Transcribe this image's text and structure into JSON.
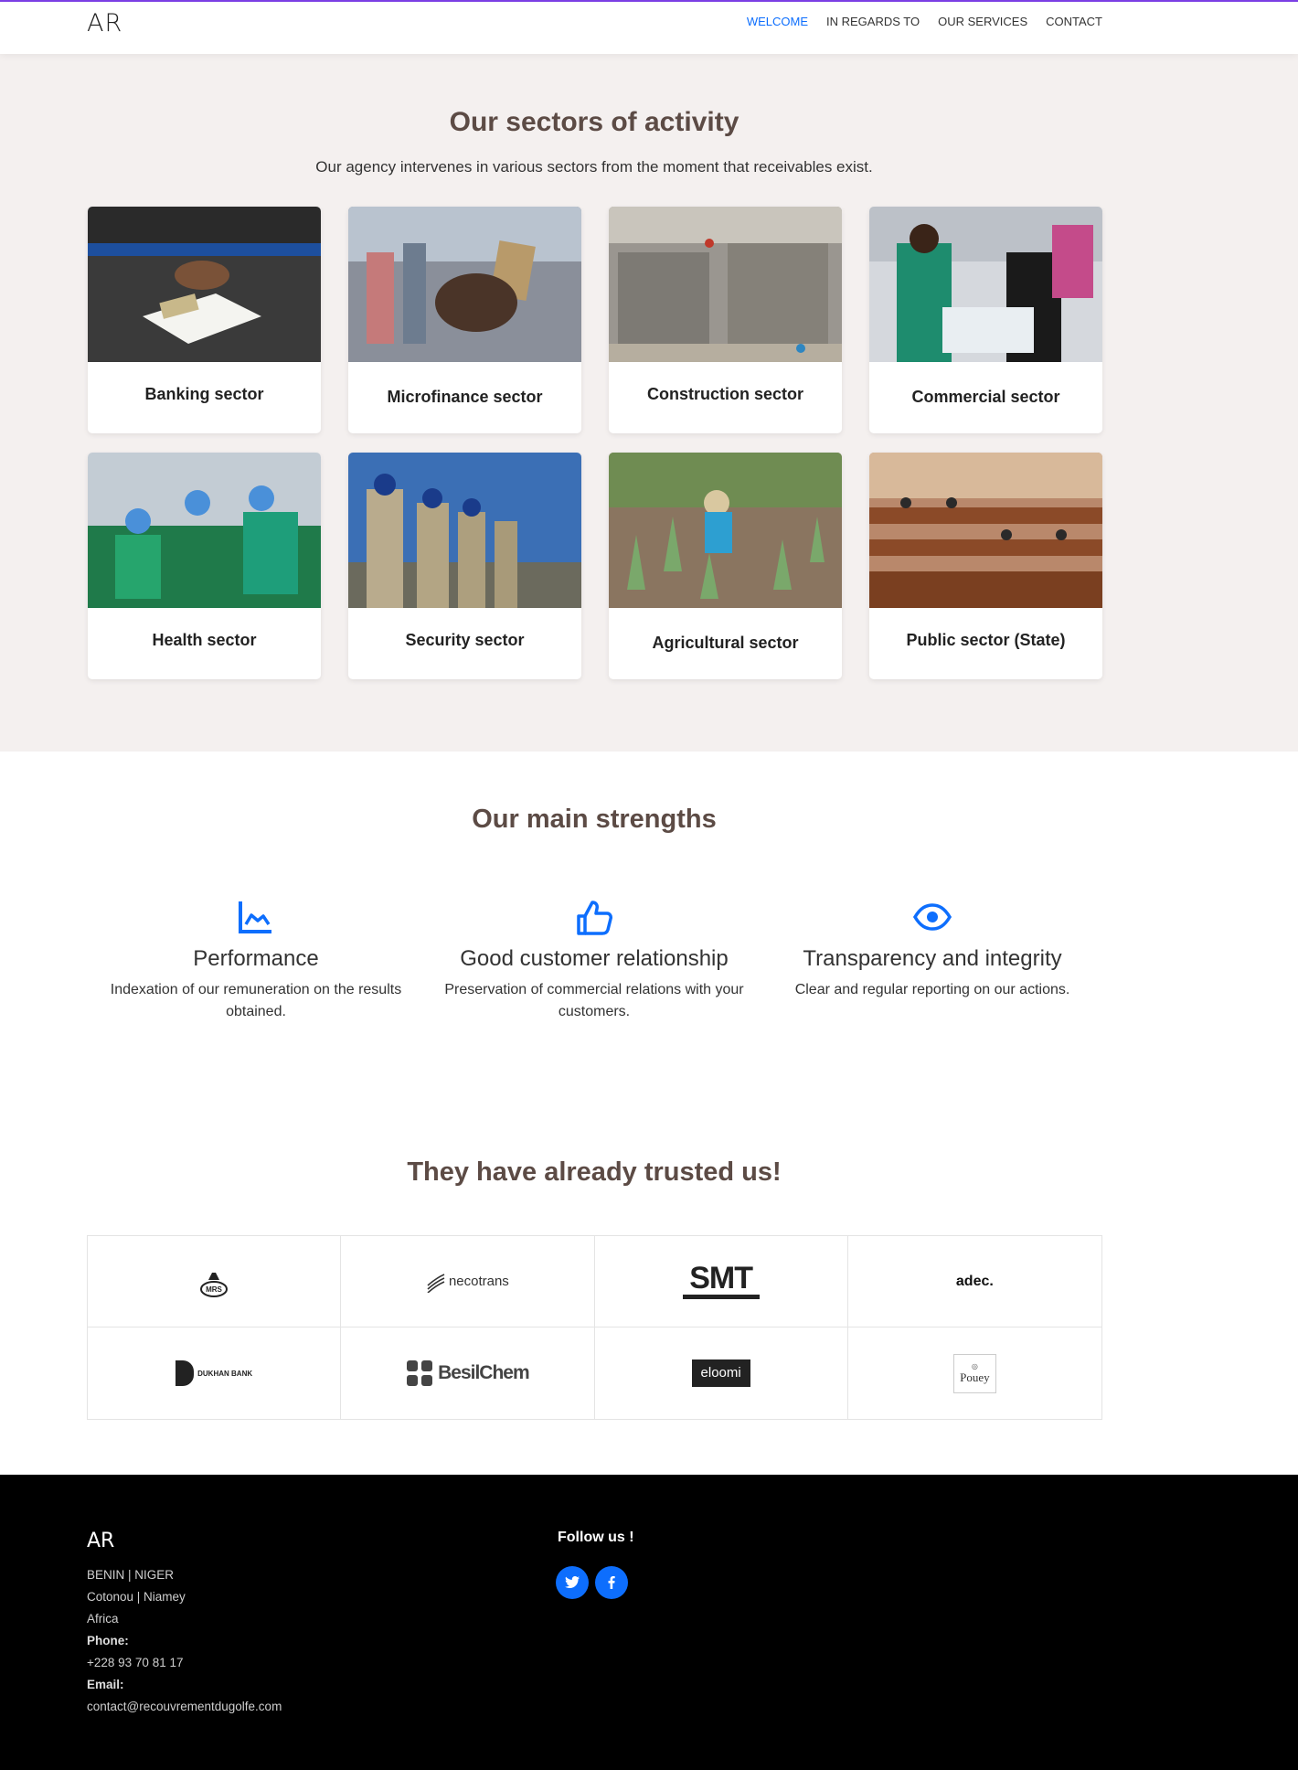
{
  "header": {
    "logo": "AR",
    "nav": [
      "WELCOME",
      "IN REGARDS TO",
      "OUR SERVICES",
      "CONTACT"
    ]
  },
  "sectors": {
    "title": "Our sectors of activity",
    "subtitle": "Our agency intervenes in various sectors from the moment that receivables exist.",
    "items": [
      {
        "label": "Banking sector"
      },
      {
        "label": "Microfinance sector"
      },
      {
        "label": "Construction sector"
      },
      {
        "label": "Commercial sector"
      },
      {
        "label": "Health sector"
      },
      {
        "label": "Security sector"
      },
      {
        "label": "Agricultural sector"
      },
      {
        "label": "Public sector (State)"
      }
    ]
  },
  "strengths": {
    "title": "Our main strengths",
    "items": [
      {
        "icon": "chart-icon",
        "heading": "Performance",
        "text": "Indexation of our remuneration on the results obtained."
      },
      {
        "icon": "thumbs-up-icon",
        "heading": "Good customer relationship",
        "text": "Preservation of commercial relations with your customers."
      },
      {
        "icon": "eye-icon",
        "heading": "Transparency and integrity",
        "text": "Clear and regular reporting on our actions."
      }
    ]
  },
  "trusted": {
    "title": "They have already trusted us!",
    "logos": [
      "MRS",
      "necotrans",
      "SMT",
      "adec.",
      "DUKHAN BANK",
      "BesilChem",
      "eloomi",
      "Pouey"
    ]
  },
  "footer": {
    "logo": "AR",
    "line1": "BENIN | NIGER",
    "line2": "Cotonou | Niamey",
    "line3": "Africa",
    "phone_label": "Phone:",
    "phone": "+228 93 70 81 17",
    "email_label": "Email:",
    "email": "contact@recouvrementdugolfe.com",
    "follow": "Follow us !"
  },
  "colors": {
    "accent": "#0d6efd",
    "heading": "#5c4b45",
    "section_bg": "#f4f0ef"
  }
}
